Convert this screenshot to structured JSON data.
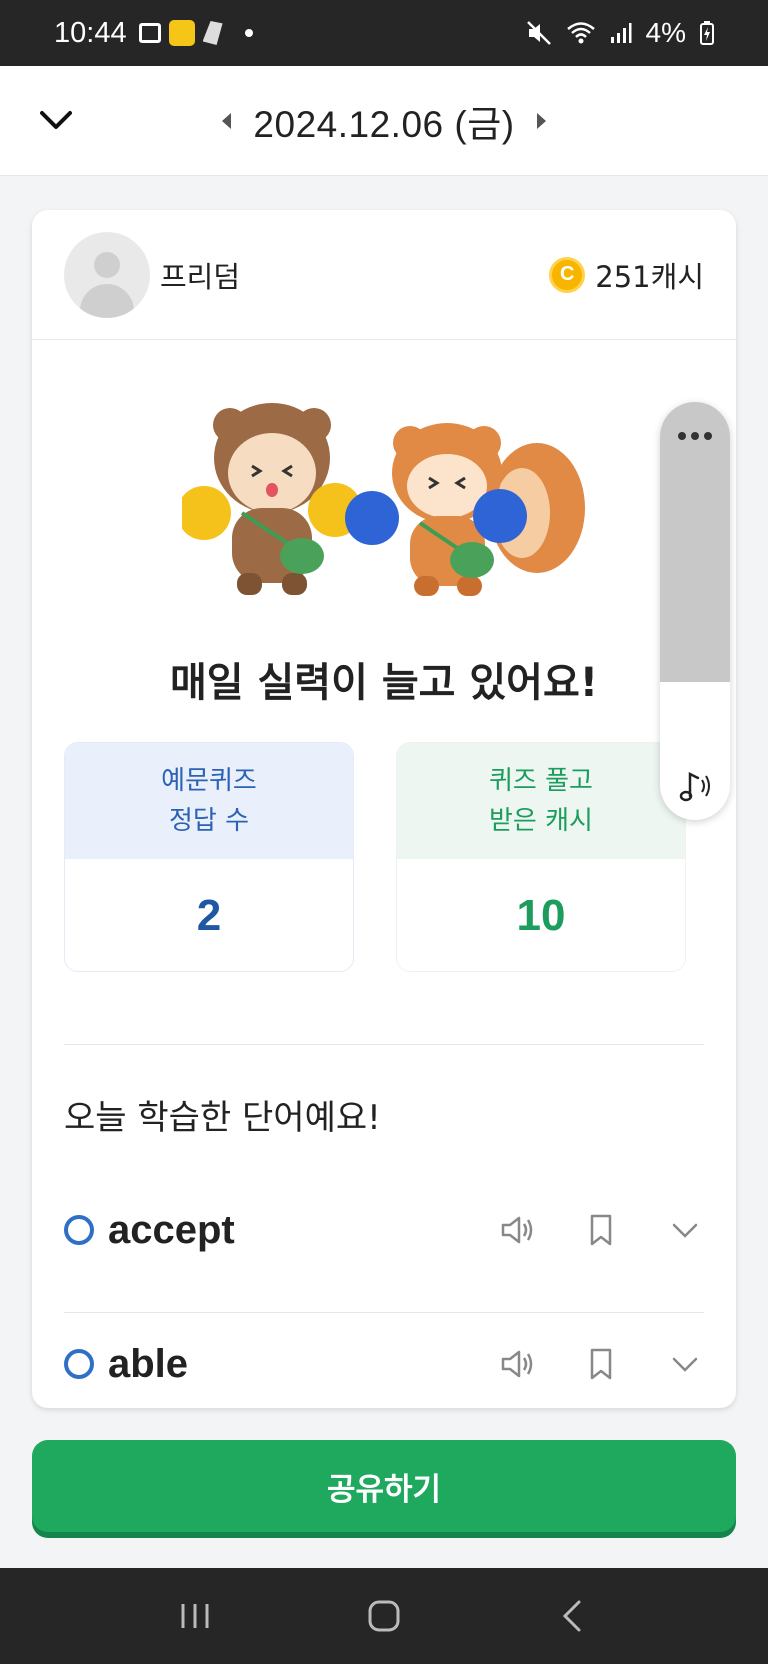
{
  "status_bar": {
    "time": "10:44",
    "battery": "4%"
  },
  "header": {
    "date": "2024.12.06 (금)"
  },
  "profile": {
    "username": "프리덤",
    "cash": "251캐시"
  },
  "headline": "매일 실력이 늘고 있어요!",
  "stats": {
    "quiz_label_1": "예문퀴즈",
    "quiz_label_2": "정답 수",
    "quiz_value": "2",
    "cash_label_1": "퀴즈 풀고",
    "cash_label_2": "받은 캐시",
    "cash_value": "10"
  },
  "words_section": {
    "title": "오늘 학습한 단어예요!",
    "words": [
      {
        "word": "accept"
      },
      {
        "word": "able"
      }
    ]
  },
  "share_button": "공유하기",
  "colors": {
    "accent_green": "#1fa95f",
    "accent_blue": "#2f6fc6"
  }
}
